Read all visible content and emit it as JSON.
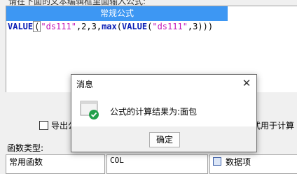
{
  "hint_text": "请在下面的文本编辑框里面输入公式:",
  "editor": {
    "header": "常规公式",
    "formula": {
      "fn1": "VALUE",
      "paren1": "(",
      "str1": "\"ds111\"",
      "args": ",2,3,",
      "fn2": "max",
      "paren2": "(",
      "fn3": "VALUE",
      "paren3": "(",
      "str2": "\"ds111\"",
      "tail": ",3)))"
    }
  },
  "options": {
    "export_label": "导出公",
    "formula_label": "式用于计算"
  },
  "function_type_label": "函数类型:",
  "lists": {
    "left_item": "常用函数",
    "mid_item": "COL",
    "right_item": "数据项"
  },
  "dialog": {
    "title": "消息",
    "close_glyph": "✕",
    "message": "公式的计算结果为:面包",
    "ok_label": "确定"
  },
  "colors": {
    "header_bg": "#3d97f3",
    "keyword": "#0b1fb5",
    "string": "#c418b8",
    "check_green": "#22a04b"
  }
}
